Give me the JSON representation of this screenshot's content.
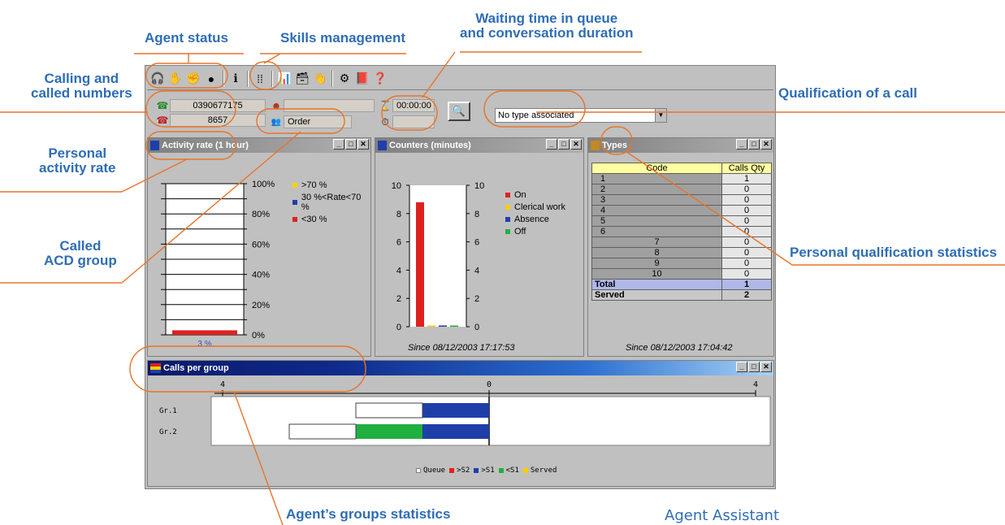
{
  "callouts": {
    "agent_status": "Agent status",
    "skills_management": "Skills management",
    "waiting_time_line1": "Waiting time in queue",
    "waiting_time_line2": "and conversation duration",
    "calling_line1": "Calling and",
    "calling_line2": "called numbers",
    "qualification": "Qualification of a call",
    "personal_rate_line1": "Personal",
    "personal_rate_line2": "activity rate",
    "called_acd_line1": "Called",
    "called_acd_line2": "ACD group",
    "personal_qual_stats": "Personal qualification statistics",
    "agent_groups_stats": "Agent’s groups statistics",
    "agent_assistant": "Agent Assistant"
  },
  "toolbar": {
    "icons": [
      "headset-icon",
      "hand-icon",
      "fist-icon",
      "stop-icon",
      "info-icon",
      "skills-icon",
      "chart-icon",
      "box-icon",
      "hand-wave-icon",
      "gear-icon",
      "book-icon",
      "help-icon"
    ]
  },
  "info": {
    "calling_number": "0390677175",
    "called_number": "8657",
    "agent_field": "",
    "acd_group": "Order",
    "waiting_time": "00:00:00",
    "conversation_time": "",
    "qualification_select": "No type associated"
  },
  "activity_panel": {
    "title": "Activity rate (1 hour)",
    "legend": [
      {
        "label": ">70 %",
        "color": "#f5d000"
      },
      {
        "label": "30 %<Rate<70 %",
        "color": "#1f3fa8"
      },
      {
        "label": "<30 %",
        "color": "#e02020"
      }
    ],
    "value_label": "3 %"
  },
  "counters_panel": {
    "title": "Counters (minutes)",
    "legend": [
      {
        "label": "On",
        "color": "#e02020"
      },
      {
        "label": "Clerical work",
        "color": "#f5d000"
      },
      {
        "label": "Absence",
        "color": "#1f3fa8"
      },
      {
        "label": "Off",
        "color": "#20b040"
      }
    ],
    "since": "Since 08/12/2003 17:17:53"
  },
  "types_panel": {
    "title": "Types",
    "col_code": "Code",
    "col_qty": "Calls Qty",
    "rows": [
      {
        "code": "1",
        "qty": "1"
      },
      {
        "code": "2",
        "qty": "0"
      },
      {
        "code": "3",
        "qty": "0"
      },
      {
        "code": "4",
        "qty": "0"
      },
      {
        "code": "5",
        "qty": "0"
      },
      {
        "code": "6",
        "qty": "0"
      },
      {
        "code": "7",
        "qty": "0"
      },
      {
        "code": "8",
        "qty": "0"
      },
      {
        "code": "9",
        "qty": "0"
      },
      {
        "code": "10",
        "qty": "0"
      }
    ],
    "total_label": "Total",
    "total_qty": "1",
    "served_label": "Served",
    "served_qty": "2",
    "since": "Since 08/12/2003 17:04:42"
  },
  "groups_panel": {
    "title": "Calls per group",
    "legend": [
      {
        "label": "Queue",
        "color": "#ffffff"
      },
      {
        "label": ">S2",
        "color": "#e02020"
      },
      {
        "label": ">S1",
        "color": "#1f3fa8"
      },
      {
        "label": "<S1",
        "color": "#20b040"
      },
      {
        "label": "Served",
        "color": "#f5d000"
      }
    ]
  },
  "chart_data": [
    {
      "type": "bar",
      "title": "Activity rate (1 hour)",
      "categories": [
        ""
      ],
      "values": [
        3
      ],
      "ylim": [
        0,
        100
      ],
      "yticks": [
        "0%",
        "20%",
        "40%",
        "60%",
        "80%",
        "100%"
      ],
      "bar_color": "#e02020"
    },
    {
      "type": "bar",
      "title": "Counters (minutes)",
      "categories": [
        "On",
        "Clerical work",
        "Absence",
        "Off"
      ],
      "values": [
        8.8,
        0,
        0,
        0
      ],
      "colors": [
        "#e02020",
        "#f5d000",
        "#1f3fa8",
        "#20b040"
      ],
      "ylim": [
        0,
        10
      ],
      "yticks": [
        "0",
        "2",
        "4",
        "6",
        "8",
        "10"
      ]
    },
    {
      "type": "bar",
      "title": "Calls per group",
      "categories": [
        "Gr.1",
        "Gr.2"
      ],
      "axis_labels": [
        "4",
        "0",
        "4"
      ],
      "series": [
        {
          "name": "Queue",
          "values": [
            1,
            1
          ]
        },
        {
          "name": "<S1",
          "values": [
            0,
            1
          ]
        },
        {
          "name": ">S1",
          "values": [
            1,
            1
          ]
        }
      ]
    }
  ]
}
